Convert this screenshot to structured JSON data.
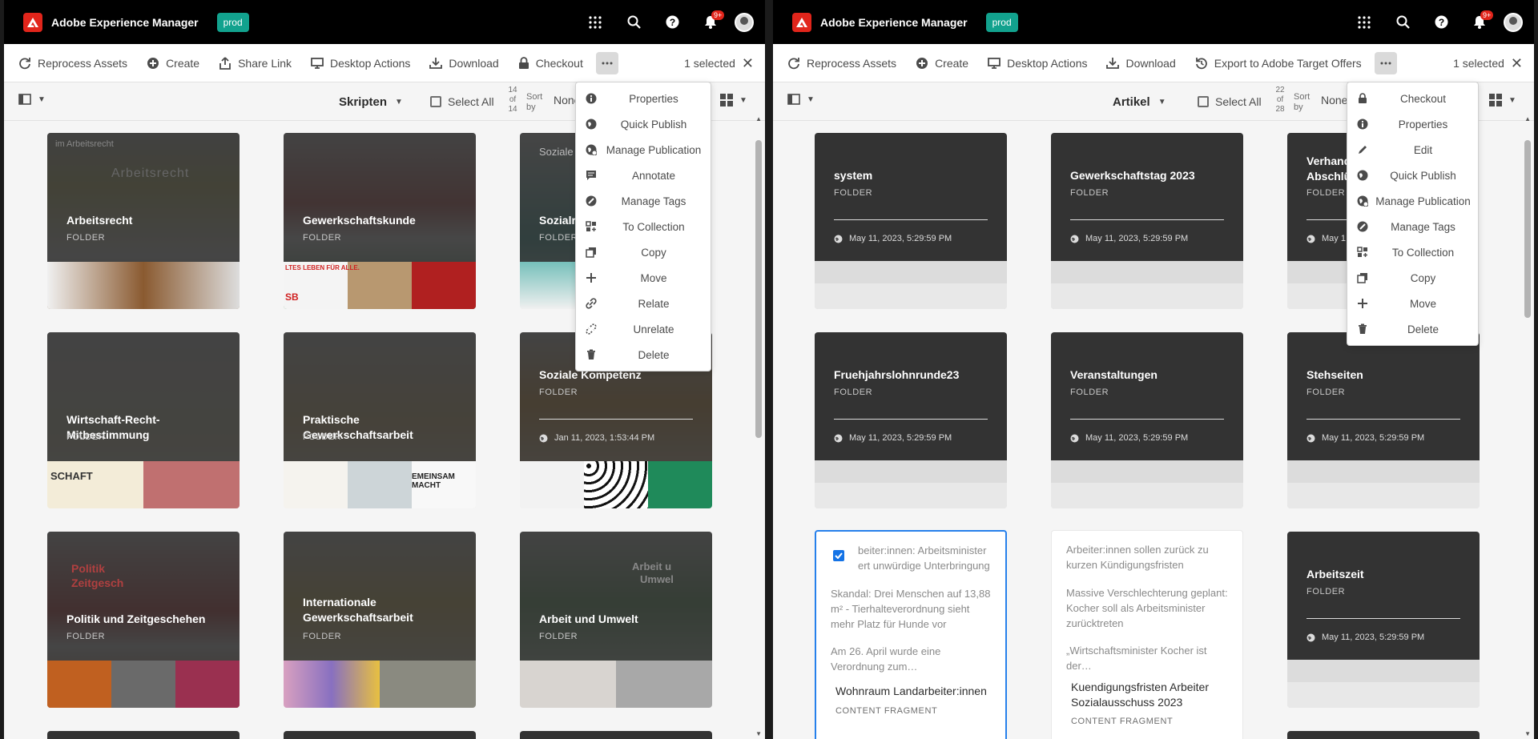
{
  "shell": {
    "app_title": "Adobe Experience Manager",
    "env_badge": "prod",
    "notification_count": "9+"
  },
  "left": {
    "actions": [
      "Reprocess Assets",
      "Create",
      "Share Link",
      "Desktop Actions",
      "Download",
      "Checkout"
    ],
    "selected_text": "1 selected",
    "folder_name": "Skripten",
    "select_all": "Select All",
    "count": {
      "a": "14",
      "of": "of",
      "b": "14"
    },
    "sort_label": "Sort by",
    "sort_value": "None",
    "menu": [
      "Properties",
      "Quick Publish",
      "Manage Publication",
      "Annotate",
      "Manage Tags",
      "To Collection",
      "Copy",
      "Move",
      "Relate",
      "Unrelate",
      "Delete"
    ],
    "cards": [
      {
        "title": "Arbeitsrecht",
        "sub": "FOLDER",
        "date": "",
        "peek": "im Arbeitsrecht",
        "peek2": "Arbeitsrecht"
      },
      {
        "title": "Gewerkschaftskunde",
        "sub": "FOLDER",
        "date": "",
        "peek": "LTES LEBEN FÜR ALLE.",
        "peek2": "SB"
      },
      {
        "title": "Sozialre",
        "sub": "FOLDER",
        "date": "",
        "peek": "Soziale",
        "peek2": ""
      },
      {
        "title": "Wirtschaft-Recht-Mitbestimmung",
        "sub": "FOLDER",
        "date": "",
        "peek": "SCHAFT",
        "peek2": ""
      },
      {
        "title": "Praktische Gewerkschaftsarbeit",
        "sub": "FOLDER",
        "date": "",
        "peek": "EMEINSAM MACHT",
        "peek2": ""
      },
      {
        "title": "Soziale Kompetenz",
        "sub": "FOLDER",
        "date": "Jan 11, 2023, 1:53:44 PM",
        "peek": "",
        "peek2": ""
      },
      {
        "title": "Politik und Zeitgeschehen",
        "sub": "FOLDER",
        "date": "",
        "peek": "Politik",
        "peek2": "Zeitgesch"
      },
      {
        "title": "Internationale Gewerkschaftsarbeit",
        "sub": "FOLDER",
        "date": "",
        "peek": "",
        "peek2": ""
      },
      {
        "title": "Arbeit und Umwelt",
        "sub": "FOLDER",
        "date": "",
        "peek": "Arbeit u",
        "peek2": "Umwel"
      }
    ]
  },
  "right": {
    "actions": [
      "Reprocess Assets",
      "Create",
      "Desktop Actions",
      "Download",
      "Export to Adobe Target Offers"
    ],
    "selected_text": "1 selected",
    "folder_name": "Artikel",
    "select_all": "Select All",
    "count": {
      "a": "22",
      "of": "of",
      "b": "28"
    },
    "sort_label": "Sort by",
    "sort_value": "None",
    "menu": [
      "Checkout",
      "Properties",
      "Edit",
      "Quick Publish",
      "Manage Publication",
      "Manage Tags",
      "To Collection",
      "Copy",
      "Move",
      "Delete"
    ],
    "folders": [
      {
        "title": "system",
        "sub": "FOLDER",
        "date": "May 11, 2023, 5:29:59 PM"
      },
      {
        "title": "Gewerkschaftstag 2023",
        "sub": "FOLDER",
        "date": "May 11, 2023, 5:29:59 PM"
      },
      {
        "title": "Verhand Abschlüs",
        "sub": "FOLDER",
        "date": "May 1"
      },
      {
        "title": "Fruehjahrslohnrunde23",
        "sub": "FOLDER",
        "date": "May 11, 2023, 5:29:59 PM"
      },
      {
        "title": "Veranstaltungen",
        "sub": "FOLDER",
        "date": "May 11, 2023, 5:29:59 PM"
      },
      {
        "title": "Stehseiten",
        "sub": "FOLDER",
        "date": "May 11, 2023, 5:29:59 PM"
      },
      {
        "title": "Arbeitszeit",
        "sub": "FOLDER",
        "date": "May 11, 2023, 5:29:59 PM"
      }
    ],
    "fragments": [
      {
        "t1": "beiter:innen: Arbeitsminister ert unwürdige Unterbringung",
        "t2": "Skandal: Drei Menschen auf 13,88 m² - Tierhalteverordnung sieht mehr Platz für Hunde vor",
        "t3": "Am 26. April wurde eine Verordnung zum…",
        "name": "Wohnraum Landarbeiter:innen",
        "sub": "CONTENT FRAGMENT"
      },
      {
        "t1": "Arbeiter:innen sollen zurück zu kurzen Kündigungsfristen",
        "t2": "Massive Verschlechterung geplant: Kocher soll als Arbeitsminister zurücktreten",
        "t3": "„Wirtschaftsminister Kocher ist der…",
        "name": "Kuendigungsfristen Arbeiter Sozialausschuss 2023",
        "sub": "CONTENT FRAGMENT"
      }
    ]
  }
}
